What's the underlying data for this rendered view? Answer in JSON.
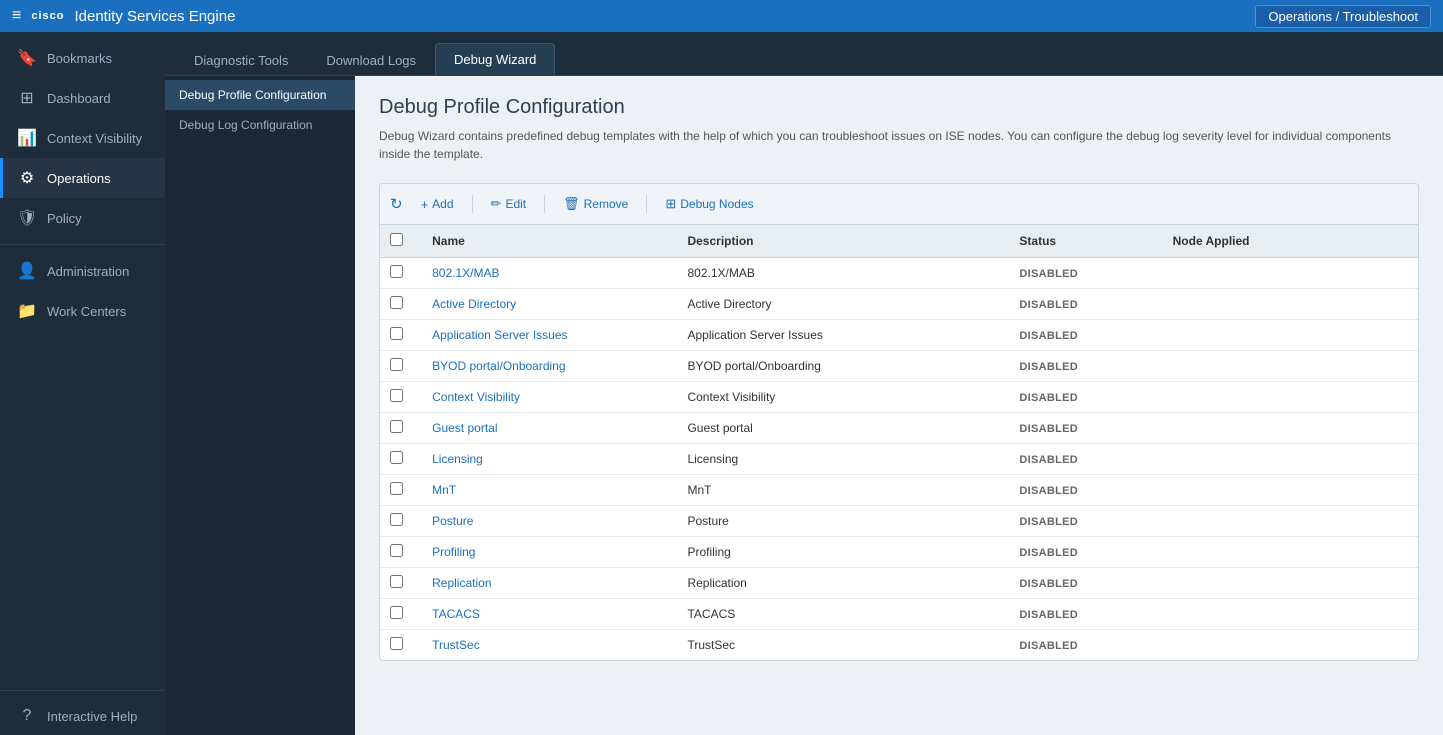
{
  "header": {
    "hamburger": "≡",
    "cisco_logo": "cisco",
    "app_title": "Identity Services Engine",
    "ops_badge": "Operations / Troubleshoot"
  },
  "sidebar": {
    "items": [
      {
        "id": "bookmarks",
        "label": "Bookmarks",
        "icon": "🔖"
      },
      {
        "id": "dashboard",
        "label": "Dashboard",
        "icon": "⊞"
      },
      {
        "id": "context-visibility",
        "label": "Context Visibility",
        "icon": "📊"
      },
      {
        "id": "operations",
        "label": "Operations",
        "icon": "⚙",
        "active": true
      },
      {
        "id": "policy",
        "label": "Policy",
        "icon": "🛡"
      },
      {
        "id": "administration",
        "label": "Administration",
        "icon": "👤"
      },
      {
        "id": "work-centers",
        "label": "Work Centers",
        "icon": "📁"
      },
      {
        "id": "interactive-help",
        "label": "Interactive Help",
        "icon": "?"
      }
    ]
  },
  "tabs": [
    {
      "id": "diagnostic-tools",
      "label": "Diagnostic Tools",
      "active": false
    },
    {
      "id": "download-logs",
      "label": "Download Logs",
      "active": false
    },
    {
      "id": "debug-wizard",
      "label": "Debug Wizard",
      "active": true
    }
  ],
  "sub_nav": [
    {
      "id": "debug-profile-config",
      "label": "Debug Profile Configuration",
      "active": true
    },
    {
      "id": "debug-log-config",
      "label": "Debug Log Configuration",
      "active": false
    }
  ],
  "page": {
    "title": "Debug Profile Configuration",
    "description": "Debug Wizard contains predefined debug templates with the help of which you can troubleshoot issues on ISE nodes. You can configure the debug log severity level for individual components inside the template."
  },
  "toolbar": {
    "add_label": "Add",
    "edit_label": "Edit",
    "remove_label": "Remove",
    "debug_nodes_label": "Debug Nodes",
    "add_icon": "+",
    "edit_icon": "✏",
    "remove_icon": "🗑",
    "debug_nodes_icon": "⊞",
    "refresh_icon": "↻"
  },
  "table": {
    "columns": [
      {
        "id": "check",
        "label": ""
      },
      {
        "id": "name",
        "label": "Name"
      },
      {
        "id": "description",
        "label": "Description"
      },
      {
        "id": "status",
        "label": "Status"
      },
      {
        "id": "node_applied",
        "label": "Node Applied"
      }
    ],
    "rows": [
      {
        "name": "802.1X/MAB",
        "description": "802.1X/MAB",
        "status": "DISABLED",
        "node_applied": ""
      },
      {
        "name": "Active Directory",
        "description": "Active Directory",
        "status": "DISABLED",
        "node_applied": ""
      },
      {
        "name": "Application Server Issues",
        "description": "Application Server Issues",
        "status": "DISABLED",
        "node_applied": ""
      },
      {
        "name": "BYOD portal/Onboarding",
        "description": "BYOD portal/Onboarding",
        "status": "DISABLED",
        "node_applied": ""
      },
      {
        "name": "Context Visibility",
        "description": "Context Visibility",
        "status": "DISABLED",
        "node_applied": ""
      },
      {
        "name": "Guest portal",
        "description": "Guest portal",
        "status": "DISABLED",
        "node_applied": ""
      },
      {
        "name": "Licensing",
        "description": "Licensing",
        "status": "DISABLED",
        "node_applied": ""
      },
      {
        "name": "MnT",
        "description": "MnT",
        "status": "DISABLED",
        "node_applied": ""
      },
      {
        "name": "Posture",
        "description": "Posture",
        "status": "DISABLED",
        "node_applied": ""
      },
      {
        "name": "Profiling",
        "description": "Profiling",
        "status": "DISABLED",
        "node_applied": ""
      },
      {
        "name": "Replication",
        "description": "Replication",
        "status": "DISABLED",
        "node_applied": ""
      },
      {
        "name": "TACACS",
        "description": "TACACS",
        "status": "DISABLED",
        "node_applied": ""
      },
      {
        "name": "TrustSec",
        "description": "TrustSec",
        "status": "DISABLED",
        "node_applied": ""
      }
    ]
  }
}
